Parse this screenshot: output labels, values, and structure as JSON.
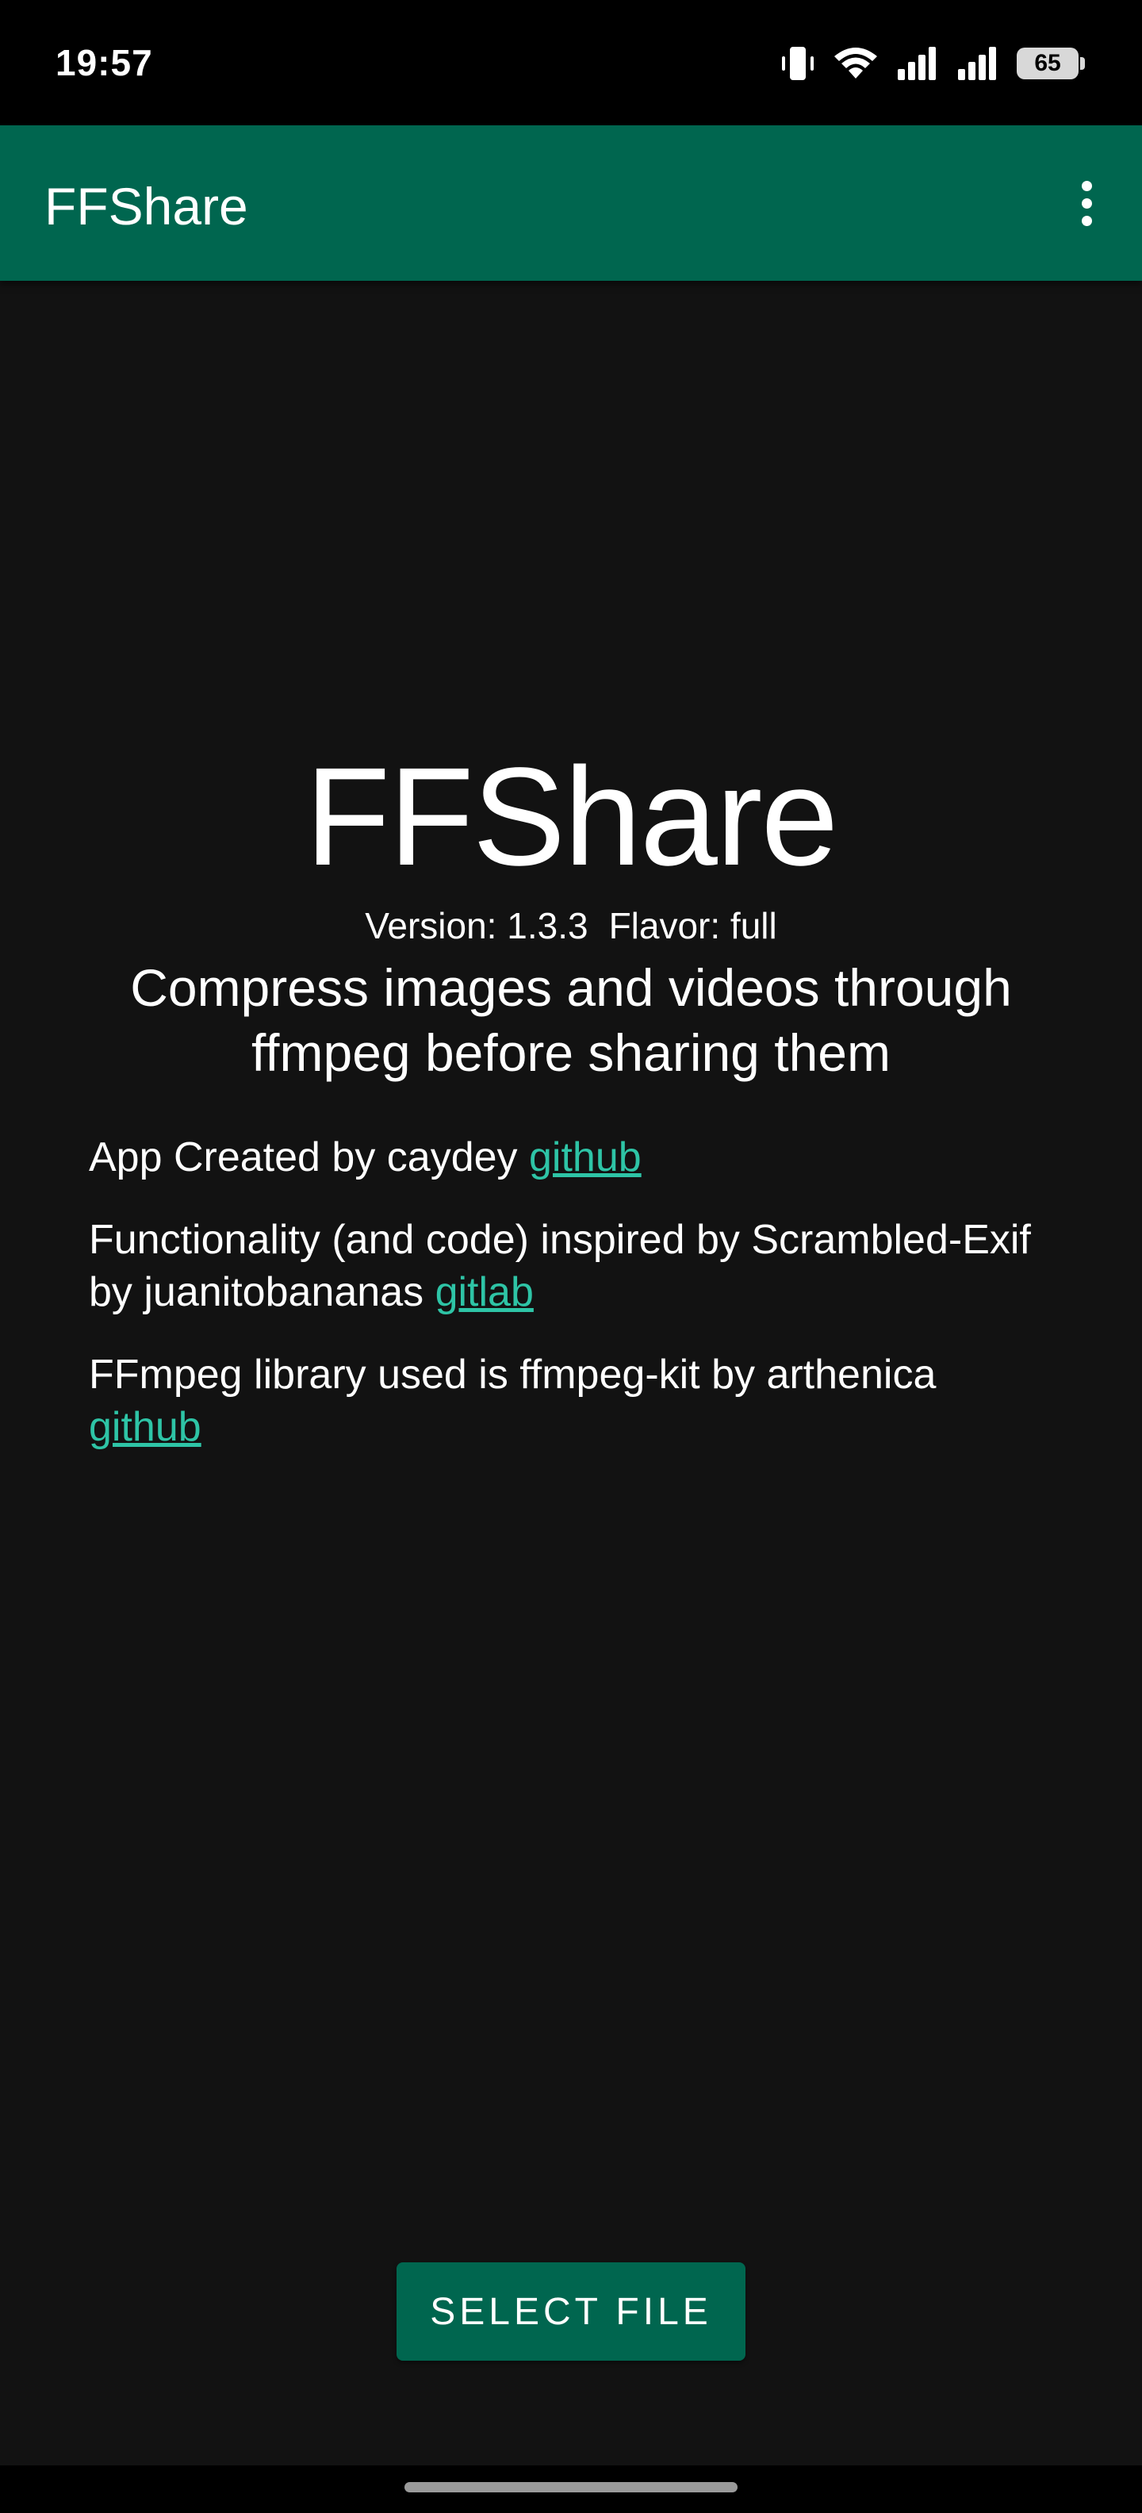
{
  "status_bar": {
    "time": "19:57",
    "battery": "65",
    "icons": [
      "vibrate-icon",
      "wifi-icon",
      "signal-icon",
      "signal-icon",
      "battery-icon"
    ]
  },
  "app_bar": {
    "title": "FFShare",
    "menu_icon": "more-vert-icon"
  },
  "main": {
    "title": "FFShare",
    "version": "Version: 1.3.3",
    "flavor": "Flavor: full",
    "tagline": "Compress images and videos through ffmpeg before sharing them",
    "credits": [
      {
        "text": "App Created by caydey ",
        "link": "github"
      },
      {
        "text": "Functionality (and code) inspired by Scrambled-Exif by juanitobananas ",
        "link": "gitlab"
      },
      {
        "text": "FFmpeg library used is ffmpeg-kit by arthenica ",
        "link": "github"
      }
    ],
    "select_button": "SELECT FILE"
  },
  "colors": {
    "primary": "#00664f",
    "background": "#121212",
    "link": "#2ec4a6",
    "status_bar": "#000000"
  }
}
